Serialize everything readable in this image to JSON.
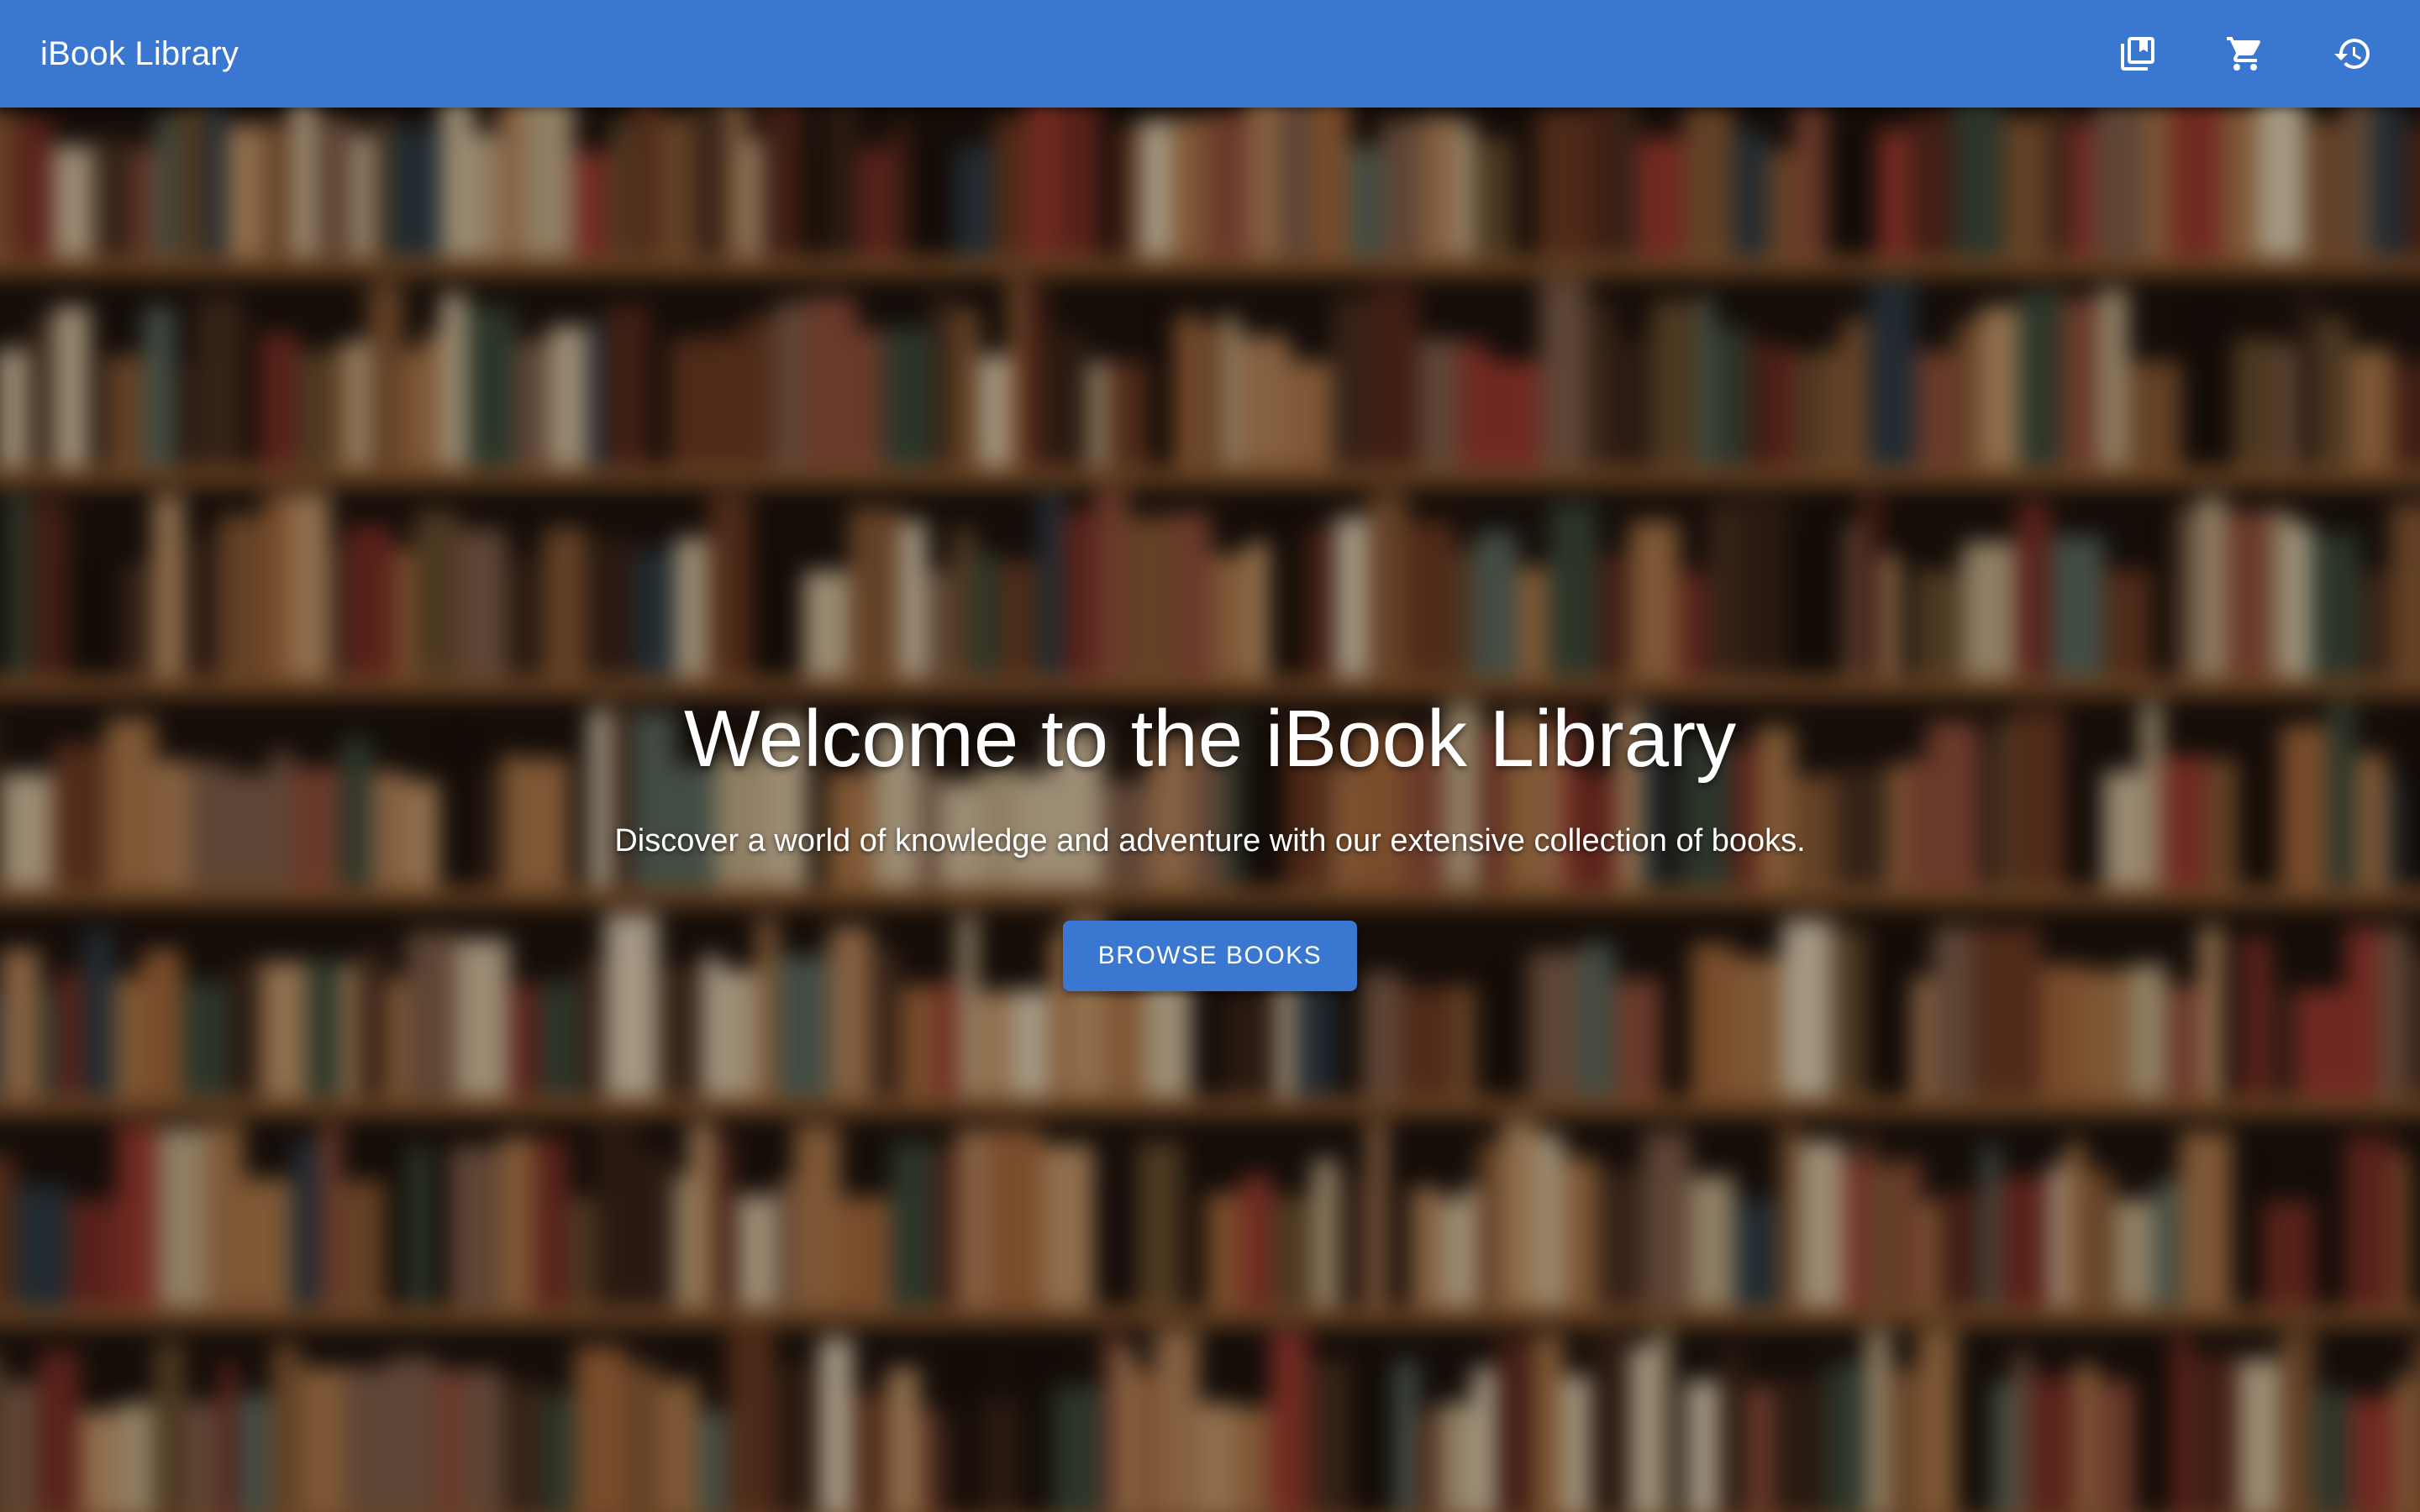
{
  "app": {
    "title": "iBook Library"
  },
  "toolbar": {
    "items": [
      {
        "icon": "library-books-icon",
        "label": ""
      },
      {
        "icon": "shopping-cart-icon",
        "label": ""
      },
      {
        "icon": "history-icon",
        "label": ""
      }
    ]
  },
  "hero": {
    "title": "Welcome to the iBook Library",
    "subtitle": "Discover a world of knowledge and adventure with our extensive collection of books.",
    "cta_label": "BROWSE BOOKS",
    "background_image": "blurred-bookshelf"
  },
  "colors": {
    "primary": "#3a77d0",
    "text_on_primary": "#ffffff"
  }
}
